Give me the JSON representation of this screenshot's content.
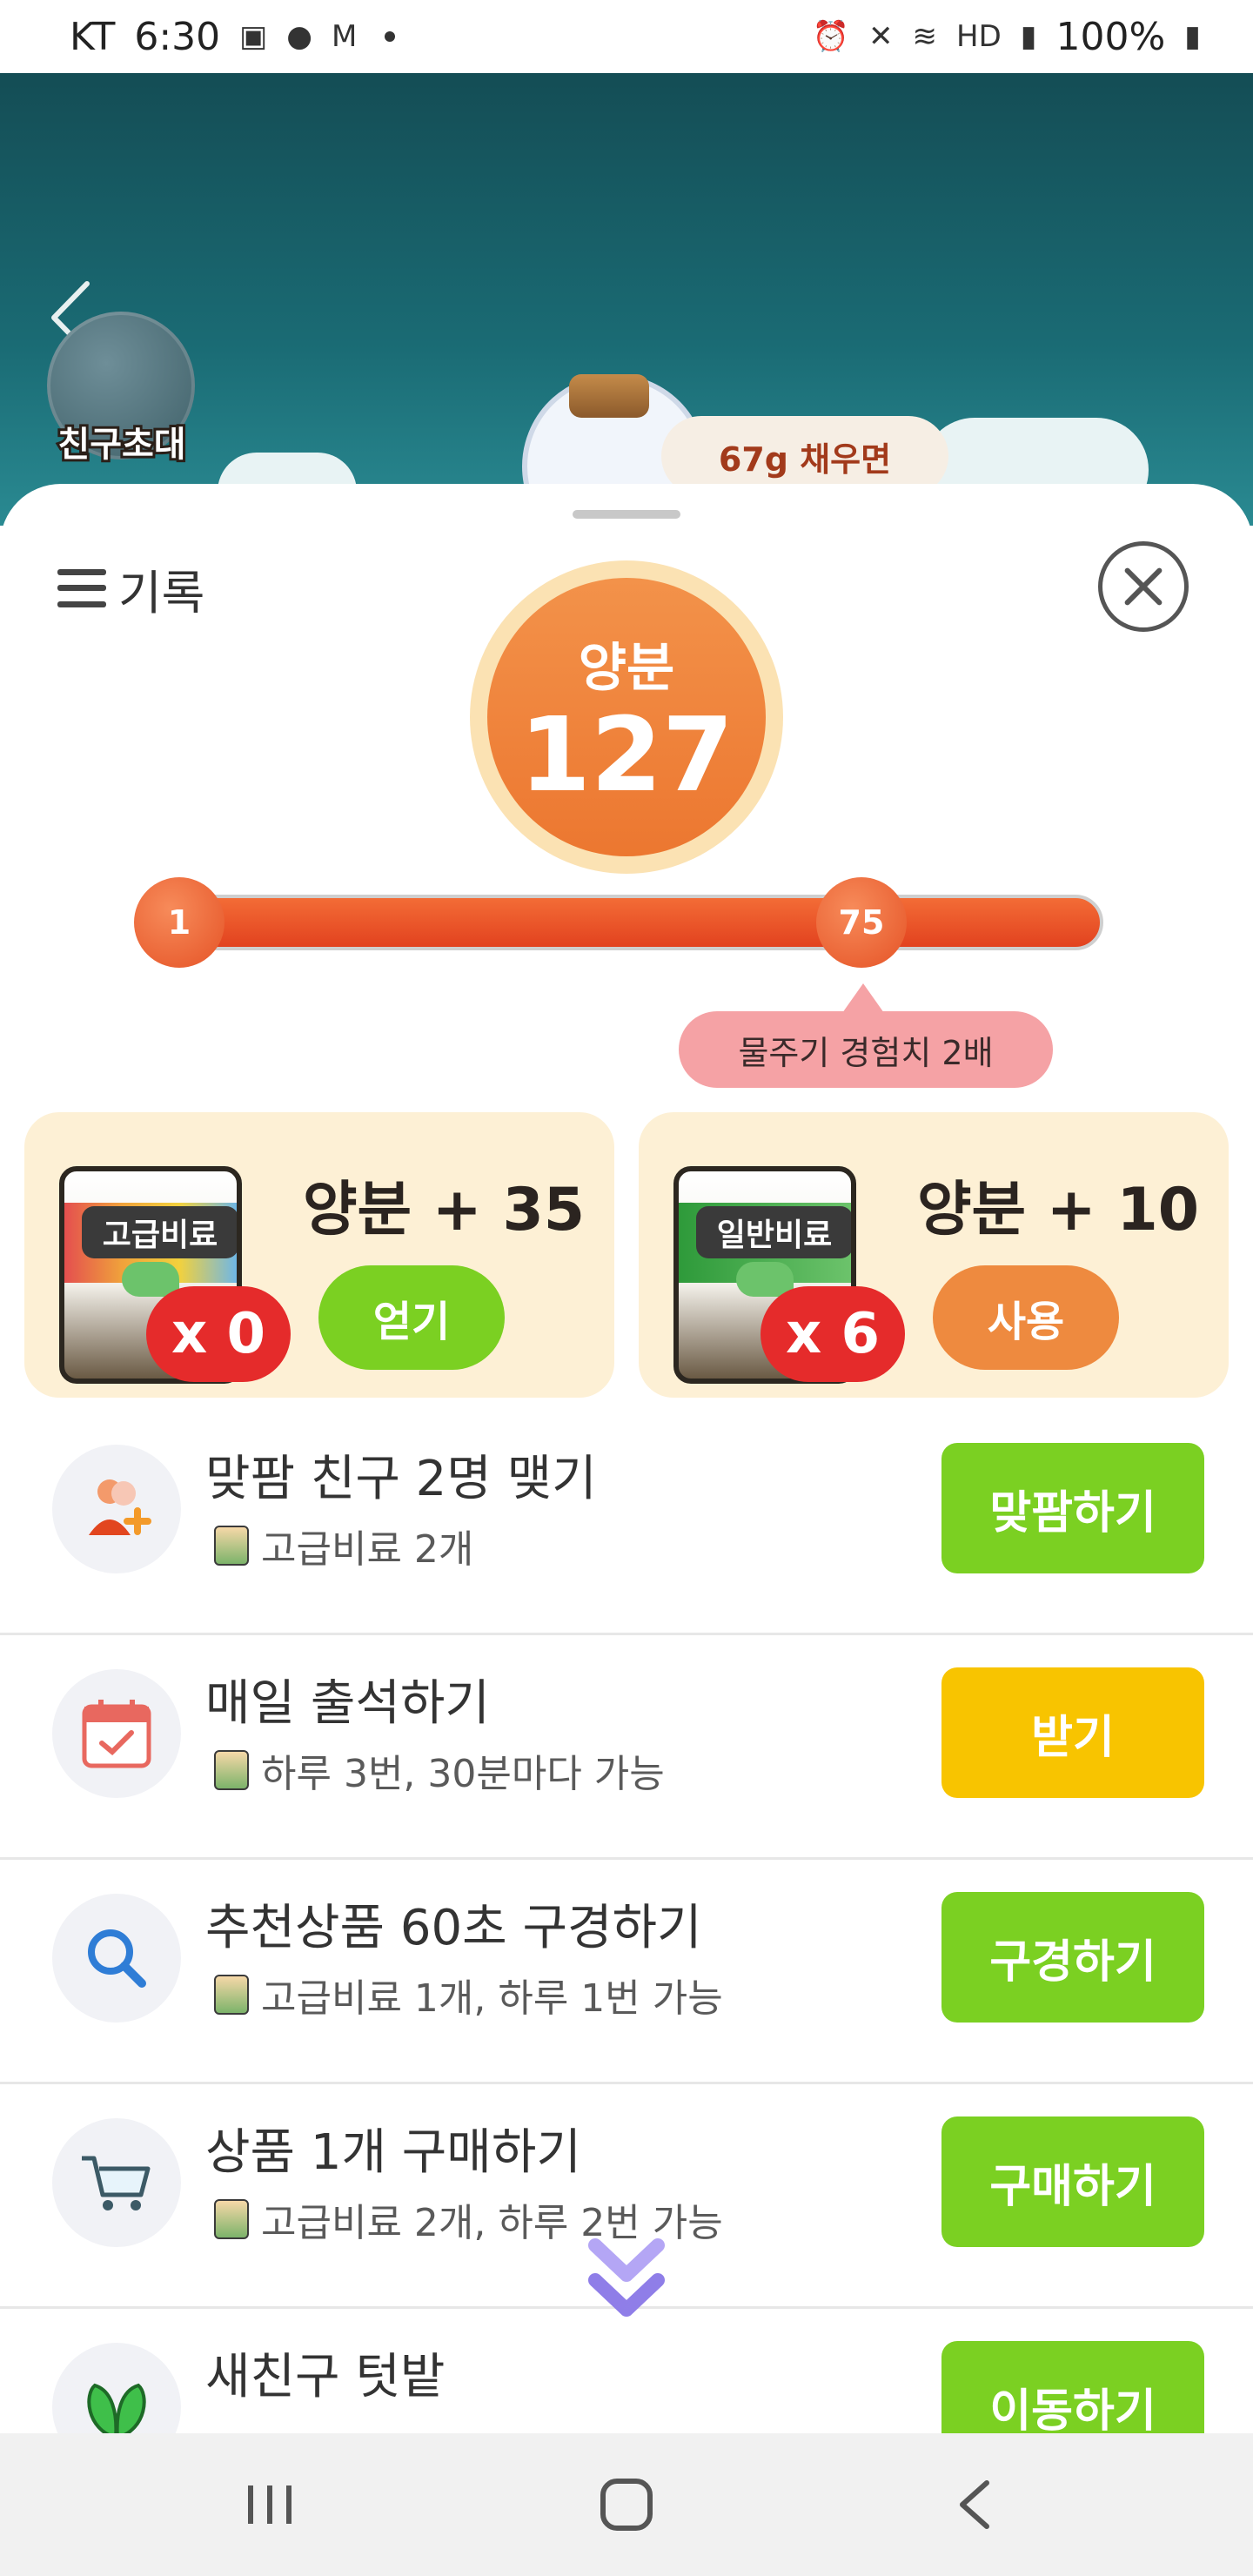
{
  "status_bar": {
    "carrier": "KT",
    "time": "6:30",
    "battery": "100%",
    "hd": "HD"
  },
  "game": {
    "invite_label": "친구초대",
    "fill_text": "67g 채우면"
  },
  "sheet": {
    "record_label": "기록",
    "nutrient": {
      "label": "양분",
      "value": "127"
    },
    "progress": {
      "start_level": "1",
      "current_level": "75",
      "tip": "물주기 경험치 2배"
    },
    "cards": [
      {
        "bag_label": "고급비료",
        "count": "x 0",
        "title": "양분 + 35",
        "button": "얻기",
        "button_color": "#7bd022"
      },
      {
        "bag_label": "일반비료",
        "count": "x 6",
        "title": "양분 + 10",
        "button": "사용",
        "button_color": "#ee8a3f"
      }
    ],
    "missions": [
      {
        "title": "맞팜 친구 2명 맺기",
        "sub": "고급비료 2개",
        "button": "맞팜하기",
        "icon": "add-friend-icon"
      },
      {
        "title": "매일 출석하기",
        "sub": "하루 3번, 30분마다 가능",
        "button": "받기",
        "icon": "calendar-check-icon"
      },
      {
        "title": "추천상품 60초 구경하기",
        "sub": "고급비료 1개, 하루 1번 가능",
        "button": "구경하기",
        "icon": "search-icon"
      },
      {
        "title": "상품 1개 구매하기",
        "sub": "고급비료 2개, 하루 2번 가능",
        "button": "구매하기",
        "icon": "cart-icon"
      },
      {
        "title": "새친구 텃밭",
        "sub": "",
        "button": "이동하기",
        "icon": "sprout-icon"
      }
    ]
  },
  "colors": {
    "accent_orange": "#ec7730",
    "green": "#7bd022",
    "yellow": "#f8c400",
    "red_badge": "#e52b2b"
  }
}
